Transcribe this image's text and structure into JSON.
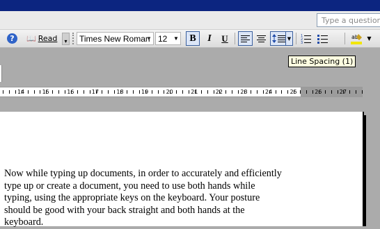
{
  "window": {
    "ask_placeholder": "Type a question f"
  },
  "toolbar": {
    "help_icon": "help-icon",
    "read_label": "Read",
    "font_name": "Times New Roman",
    "font_size": "12",
    "bold": "B",
    "italic": "I",
    "underline": "U",
    "tooltip": "Line Spacing (1)"
  },
  "ruler": {
    "labels": [
      "14",
      "15",
      "16",
      "17",
      "18",
      "19",
      "20",
      "21",
      "22",
      "23",
      "24",
      "25",
      "26",
      "27"
    ]
  },
  "document": {
    "lines": [
      "Now while typing up documents, in order to accurately and efficiently",
      "type up or create a document, you need to use both hands while",
      "typing, using the appropriate keys on the keyboard. Your posture",
      "should be good with your back straight and both hands at the",
      "keyboard."
    ]
  },
  "colors": {
    "titlebar": "#0c2580",
    "highlight": "#dce6f7",
    "tooltip_bg": "#ffffe1"
  }
}
